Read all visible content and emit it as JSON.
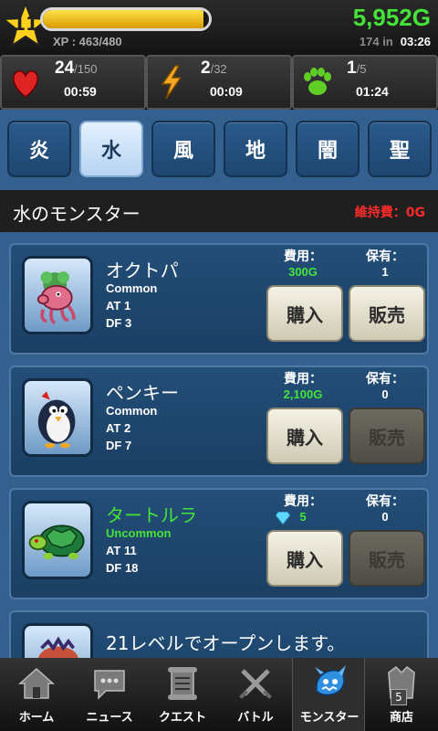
{
  "status": {
    "level": "11",
    "xp_label": "XP : 463/480",
    "xp_progress": 0.965,
    "gold": "5,952G",
    "gold_timer_prefix": "174 in",
    "gold_timer": "03:26"
  },
  "resources": [
    {
      "icon": "heart-icon",
      "value": "24",
      "max": "/150",
      "timer": "00:59"
    },
    {
      "icon": "lightning-icon",
      "value": "2",
      "max": "/32",
      "timer": "00:09"
    },
    {
      "icon": "paw-icon",
      "value": "1",
      "max": "/5",
      "timer": "01:24"
    }
  ],
  "tabs": [
    "炎",
    "水",
    "風",
    "地",
    "闇",
    "聖"
  ],
  "active_tab": "水",
  "section": {
    "title": "水のモンスター",
    "maintenance": "維持費：0G"
  },
  "labels": {
    "cost": "費用：",
    "owned": "保有：",
    "buy": "購入",
    "sell": "販売"
  },
  "monsters": [
    {
      "name": "オクトパ",
      "rarity": "Common",
      "at": "AT 1",
      "df": "DF 3",
      "cost": "300G",
      "owned": "1",
      "sell_enabled": true
    },
    {
      "name": "ペンキー",
      "rarity": "Common",
      "at": "AT 2",
      "df": "DF 7",
      "cost": "2,100G",
      "owned": "0",
      "sell_enabled": false
    },
    {
      "name": "タートルラ",
      "rarity": "Uncommon",
      "at": "AT 11",
      "df": "DF 18",
      "cost": "5",
      "owned": "0",
      "sell_enabled": false
    }
  ],
  "locked": {
    "text": "21レベルでオープンします。"
  },
  "nav": [
    {
      "label": "ホーム",
      "icon": "home-icon"
    },
    {
      "label": "ニュース",
      "icon": "chat-bubble-icon"
    },
    {
      "label": "クエスト",
      "icon": "scroll-icon"
    },
    {
      "label": "バトル",
      "icon": "crossed-swords-icon"
    },
    {
      "label": "モンスター",
      "icon": "dragon-icon"
    },
    {
      "label": "商店",
      "icon": "shop-icon",
      "badge": "5"
    }
  ],
  "colors": {
    "accent_green": "#45e339",
    "warning_red": "#ff2a2a",
    "bg_blue": "#33608e"
  }
}
